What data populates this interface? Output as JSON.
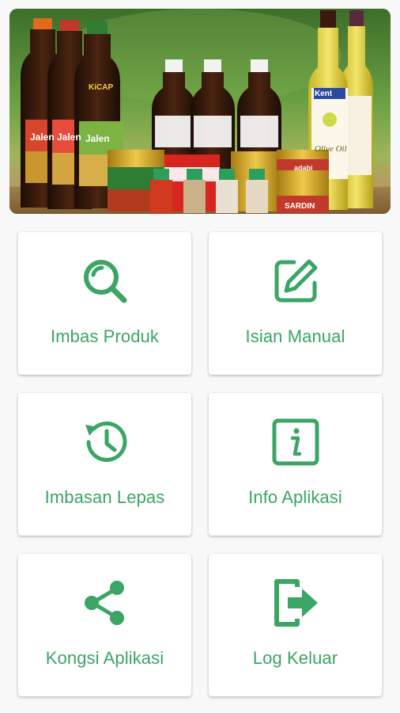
{
  "theme": {
    "accent": "#3aa564",
    "card_bg": "#ffffff",
    "page_bg": "#f8f8f8"
  },
  "banner": {
    "alt": "Product banner",
    "brands": [
      "Jalen",
      "KiCAP",
      "adabi",
      "Kent",
      "Olive Oil",
      "SARDIN"
    ]
  },
  "menu": {
    "items": [
      {
        "label": "Imbas Produk",
        "icon": "search-icon"
      },
      {
        "label": "Isian Manual",
        "icon": "edit-icon"
      },
      {
        "label": "Imbasan Lepas",
        "icon": "history-icon"
      },
      {
        "label": "Info Aplikasi",
        "icon": "info-icon"
      },
      {
        "label": "Kongsi Aplikasi",
        "icon": "share-icon"
      },
      {
        "label": "Log Keluar",
        "icon": "logout-icon"
      }
    ]
  }
}
